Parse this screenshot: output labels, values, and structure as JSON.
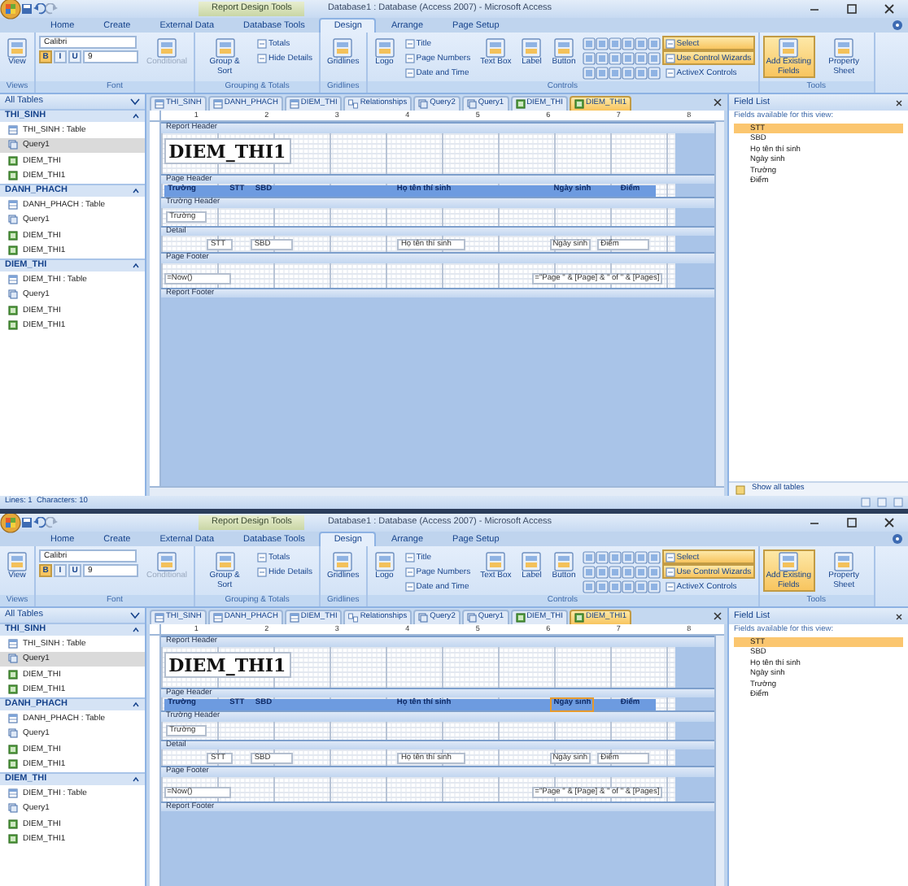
{
  "windows": [
    {
      "title": "Database1 : Database (Access 2007) - Microsoft Access",
      "context_label": "Report Design Tools",
      "ribbon_tabs": [
        {
          "label": "Home",
          "selected": false
        },
        {
          "label": "Create",
          "selected": false
        },
        {
          "label": "External Data",
          "selected": false
        },
        {
          "label": "Database Tools",
          "selected": false
        },
        {
          "label": "Design",
          "selected": true
        },
        {
          "label": "Arrange",
          "selected": false
        },
        {
          "label": "Page Setup",
          "selected": false
        }
      ],
      "ribbon_groups": [
        {
          "label": "Views",
          "controls": [
            {
              "kind": "large",
              "label": "View"
            }
          ]
        },
        {
          "label": "Font",
          "controls": [
            {
              "kind": "combo",
              "label": "Calibri"
            },
            {
              "kind": "format",
              "label": "B",
              "selected": true
            },
            {
              "kind": "format",
              "label": "I",
              "selected": false
            },
            {
              "kind": "format",
              "label": "U",
              "selected": false
            },
            {
              "kind": "combo",
              "label": "9"
            },
            {
              "kind": "large",
              "label": "Conditional",
              "disabled": true
            }
          ]
        },
        {
          "label": "Grouping & Totals",
          "controls": [
            {
              "kind": "large",
              "label": "Group & Sort"
            },
            {
              "kind": "small",
              "label": "Totals"
            },
            {
              "kind": "small",
              "label": "Hide Details"
            }
          ]
        },
        {
          "label": "Gridlines",
          "controls": [
            {
              "kind": "large",
              "label": "Gridlines"
            }
          ]
        },
        {
          "label": "Controls",
          "controls": [
            {
              "kind": "large",
              "label": "Logo"
            },
            {
              "kind": "small",
              "label": "Title"
            },
            {
              "kind": "small",
              "label": "Page Numbers"
            },
            {
              "kind": "small",
              "label": "Date and Time"
            },
            {
              "kind": "large",
              "label": "Text Box"
            },
            {
              "kind": "large",
              "label": "Label"
            },
            {
              "kind": "large",
              "label": "Button"
            },
            {
              "kind": "gallery"
            },
            {
              "kind": "small",
              "label": "Select",
              "selected": true
            },
            {
              "kind": "small",
              "label": "Use Control Wizards",
              "selected": true
            },
            {
              "kind": "small",
              "label": "ActiveX Controls",
              "selected": false
            }
          ]
        },
        {
          "label": "Tools",
          "controls": [
            {
              "kind": "large",
              "label": "Add Existing Fields",
              "selected": true
            },
            {
              "kind": "large",
              "label": "Property Sheet",
              "selected": false
            }
          ]
        }
      ],
      "nav": {
        "title": "All Tables",
        "groups": [
          {
            "name": "THI_SINH",
            "items": [
              {
                "kind": "table",
                "label": "THI_SINH : Table",
                "selected": false
              },
              {
                "kind": "query",
                "label": "Query1",
                "selected": true
              },
              {
                "kind": "report",
                "label": "DIEM_THI",
                "selected": false
              },
              {
                "kind": "report",
                "label": "DIEM_THI1",
                "selected": false
              }
            ]
          },
          {
            "name": "DANH_PHACH",
            "items": [
              {
                "kind": "table",
                "label": "DANH_PHACH : Table",
                "selected": false
              },
              {
                "kind": "query",
                "label": "Query1",
                "selected": false
              },
              {
                "kind": "report",
                "label": "DIEM_THI",
                "selected": false
              },
              {
                "kind": "report",
                "label": "DIEM_THI1",
                "selected": false
              }
            ]
          },
          {
            "name": "DIEM_THI",
            "items": [
              {
                "kind": "table",
                "label": "DIEM_THI : Table",
                "selected": false
              },
              {
                "kind": "query",
                "label": "Query1",
                "selected": false
              },
              {
                "kind": "report",
                "label": "DIEM_THI",
                "selected": false
              },
              {
                "kind": "report",
                "label": "DIEM_THI1",
                "selected": false
              }
            ]
          }
        ]
      },
      "document_tabs": [
        {
          "kind": "table",
          "label": "THI_SINH",
          "selected": false
        },
        {
          "kind": "table",
          "label": "DANH_PHACH",
          "selected": false
        },
        {
          "kind": "table",
          "label": "DIEM_THI",
          "selected": false
        },
        {
          "kind": "relationships",
          "label": "Relationships",
          "selected": false
        },
        {
          "kind": "query",
          "label": "Query2",
          "selected": false
        },
        {
          "kind": "query",
          "label": "Query1",
          "selected": false
        },
        {
          "kind": "report",
          "label": "DIEM_THI",
          "selected": false
        },
        {
          "kind": "report",
          "label": "DIEM_THI1",
          "selected": true
        }
      ],
      "ruler": [
        "1",
        "2",
        "3",
        "4",
        "5",
        "6",
        "7",
        "8"
      ],
      "sections": [
        {
          "name": "Report Header",
          "kind": "report_header",
          "controls": [
            {
              "kind": "title",
              "text": "DIEM_THI1",
              "selected": false
            }
          ]
        },
        {
          "name": "Page Header",
          "kind": "page_header",
          "controls": [
            {
              "kind": "label",
              "text": "Trường",
              "selected": false
            },
            {
              "kind": "label",
              "text": "STT",
              "selected": false
            },
            {
              "kind": "label",
              "text": "SBD",
              "selected": false
            },
            {
              "kind": "label",
              "text": "Họ tên thí sinh",
              "selected": false
            },
            {
              "kind": "label",
              "text": "Ngày sinh",
              "selected": false
            },
            {
              "kind": "label",
              "text": "Điểm",
              "selected": false
            }
          ]
        },
        {
          "name": "Trường Header",
          "kind": "group_header",
          "controls": [
            {
              "kind": "textbox",
              "text": "Trường",
              "selected": false
            }
          ]
        },
        {
          "name": "Detail",
          "kind": "detail",
          "controls": [
            {
              "kind": "textbox",
              "text": "STT",
              "selected": false
            },
            {
              "kind": "textbox",
              "text": "SBD",
              "selected": false
            },
            {
              "kind": "textbox",
              "text": "Họ tên thí sinh",
              "selected": false
            },
            {
              "kind": "textbox",
              "text": "Ngày sinh",
              "selected": false
            },
            {
              "kind": "textbox",
              "text": "Điểm",
              "selected": false
            }
          ]
        },
        {
          "name": "Page Footer",
          "kind": "page_footer",
          "controls": [
            {
              "kind": "textbox",
              "text": "=Now()",
              "selected": false
            },
            {
              "kind": "textbox",
              "text": "=\"Page \" & [Page] & \" of \" & [Pages]",
              "selected": false
            }
          ]
        },
        {
          "name": "Report Footer",
          "kind": "report_footer"
        }
      ],
      "field_list": {
        "title": "Field List",
        "subtitle": "Fields available for this view:",
        "fields": [
          {
            "label": "STT",
            "selected": true
          },
          {
            "label": "SBD",
            "selected": false
          },
          {
            "label": "Họ tên thí sinh",
            "selected": false
          },
          {
            "label": "Ngày sinh",
            "selected": false
          },
          {
            "label": "Trường",
            "selected": false
          },
          {
            "label": "Điểm",
            "selected": false
          }
        ],
        "footer_link": "Show all tables"
      },
      "status_bar": "Lines: 1  Characters: 10"
    },
    {
      "title": "Database1 : Database (Access 2007) - Microsoft Access",
      "context_label": "Report Design Tools",
      "ribbon_tabs": [
        {
          "label": "Home",
          "selected": false
        },
        {
          "label": "Create",
          "selected": false
        },
        {
          "label": "External Data",
          "selected": false
        },
        {
          "label": "Database Tools",
          "selected": false
        },
        {
          "label": "Design",
          "selected": true
        },
        {
          "label": "Arrange",
          "selected": false
        },
        {
          "label": "Page Setup",
          "selected": false
        }
      ],
      "ribbon_groups": [
        {
          "label": "Views",
          "controls": [
            {
              "kind": "large",
              "label": "View"
            }
          ]
        },
        {
          "label": "Font",
          "controls": [
            {
              "kind": "combo",
              "label": "Calibri"
            },
            {
              "kind": "format",
              "label": "B",
              "selected": true
            },
            {
              "kind": "format",
              "label": "I",
              "selected": false
            },
            {
              "kind": "format",
              "label": "U",
              "selected": false
            },
            {
              "kind": "combo",
              "label": "9"
            },
            {
              "kind": "large",
              "label": "Conditional",
              "disabled": true
            }
          ]
        },
        {
          "label": "Grouping & Totals",
          "controls": [
            {
              "kind": "large",
              "label": "Group & Sort"
            },
            {
              "kind": "small",
              "label": "Totals"
            },
            {
              "kind": "small",
              "label": "Hide Details"
            }
          ]
        },
        {
          "label": "Gridlines",
          "controls": [
            {
              "kind": "large",
              "label": "Gridlines"
            }
          ]
        },
        {
          "label": "Controls",
          "controls": [
            {
              "kind": "large",
              "label": "Logo"
            },
            {
              "kind": "small",
              "label": "Title"
            },
            {
              "kind": "small",
              "label": "Page Numbers"
            },
            {
              "kind": "small",
              "label": "Date and Time"
            },
            {
              "kind": "large",
              "label": "Text Box"
            },
            {
              "kind": "large",
              "label": "Label"
            },
            {
              "kind": "large",
              "label": "Button"
            },
            {
              "kind": "gallery"
            },
            {
              "kind": "small",
              "label": "Select",
              "selected": true
            },
            {
              "kind": "small",
              "label": "Use Control Wizards",
              "selected": true
            },
            {
              "kind": "small",
              "label": "ActiveX Controls",
              "selected": false
            }
          ]
        },
        {
          "label": "Tools",
          "controls": [
            {
              "kind": "large",
              "label": "Add Existing Fields",
              "selected": true
            },
            {
              "kind": "large",
              "label": "Property Sheet",
              "selected": false
            }
          ]
        }
      ],
      "nav": {
        "title": "All Tables",
        "groups": [
          {
            "name": "THI_SINH",
            "items": [
              {
                "kind": "table",
                "label": "THI_SINH : Table",
                "selected": false
              },
              {
                "kind": "query",
                "label": "Query1",
                "selected": true
              },
              {
                "kind": "report",
                "label": "DIEM_THI",
                "selected": false
              },
              {
                "kind": "report",
                "label": "DIEM_THI1",
                "selected": false
              }
            ]
          },
          {
            "name": "DANH_PHACH",
            "items": [
              {
                "kind": "table",
                "label": "DANH_PHACH : Table",
                "selected": false
              },
              {
                "kind": "query",
                "label": "Query1",
                "selected": false
              },
              {
                "kind": "report",
                "label": "DIEM_THI",
                "selected": false
              },
              {
                "kind": "report",
                "label": "DIEM_THI1",
                "selected": false
              }
            ]
          },
          {
            "name": "DIEM_THI",
            "items": [
              {
                "kind": "table",
                "label": "DIEM_THI : Table",
                "selected": false
              },
              {
                "kind": "query",
                "label": "Query1",
                "selected": false
              },
              {
                "kind": "report",
                "label": "DIEM_THI",
                "selected": false
              },
              {
                "kind": "report",
                "label": "DIEM_THI1",
                "selected": false
              }
            ]
          }
        ]
      },
      "document_tabs": [
        {
          "kind": "table",
          "label": "THI_SINH",
          "selected": false
        },
        {
          "kind": "table",
          "label": "DANH_PHACH",
          "selected": false
        },
        {
          "kind": "table",
          "label": "DIEM_THI",
          "selected": false
        },
        {
          "kind": "relationships",
          "label": "Relationships",
          "selected": false
        },
        {
          "kind": "query",
          "label": "Query2",
          "selected": false
        },
        {
          "kind": "query",
          "label": "Query1",
          "selected": false
        },
        {
          "kind": "report",
          "label": "DIEM_THI",
          "selected": false
        },
        {
          "kind": "report",
          "label": "DIEM_THI1",
          "selected": true
        }
      ],
      "ruler": [
        "1",
        "2",
        "3",
        "4",
        "5",
        "6",
        "7",
        "8"
      ],
      "sections": [
        {
          "name": "Report Header",
          "kind": "report_header",
          "controls": [
            {
              "kind": "title",
              "text": "DIEM_THI1",
              "selected": false
            }
          ]
        },
        {
          "name": "Page Header",
          "kind": "page_header",
          "controls": [
            {
              "kind": "label",
              "text": "Trường",
              "selected": false
            },
            {
              "kind": "label",
              "text": "STT",
              "selected": false
            },
            {
              "kind": "label",
              "text": "SBD",
              "selected": false
            },
            {
              "kind": "label",
              "text": "Họ tên thí sinh",
              "selected": false
            },
            {
              "kind": "label",
              "text": "Ngày sinh",
              "selected": true
            },
            {
              "kind": "label",
              "text": "Điểm",
              "selected": false
            }
          ]
        },
        {
          "name": "Trường Header",
          "kind": "group_header",
          "controls": [
            {
              "kind": "textbox",
              "text": "Trường",
              "selected": false
            }
          ]
        },
        {
          "name": "Detail",
          "kind": "detail",
          "controls": [
            {
              "kind": "textbox",
              "text": "STT",
              "selected": false
            },
            {
              "kind": "textbox",
              "text": "SBD",
              "selected": false
            },
            {
              "kind": "textbox",
              "text": "Họ tên thí sinh",
              "selected": false
            },
            {
              "kind": "textbox",
              "text": "Ngày sinh",
              "selected": false
            },
            {
              "kind": "textbox",
              "text": "Điểm",
              "selected": false
            }
          ]
        },
        {
          "name": "Page Footer",
          "kind": "page_footer",
          "controls": [
            {
              "kind": "textbox",
              "text": "=Now()",
              "selected": false
            },
            {
              "kind": "textbox",
              "text": "=\"Page \" & [Page] & \" of \" & [Pages]",
              "selected": false
            }
          ]
        },
        {
          "name": "Report Footer",
          "kind": "report_footer"
        }
      ],
      "field_list": {
        "title": "Field List",
        "subtitle": "Fields available for this view:",
        "fields": [
          {
            "label": "STT",
            "selected": true
          },
          {
            "label": "SBD",
            "selected": false
          },
          {
            "label": "Họ tên thí sinh",
            "selected": false
          },
          {
            "label": "Ngày sinh",
            "selected": false
          },
          {
            "label": "Trường",
            "selected": false
          },
          {
            "label": "Điểm",
            "selected": false
          }
        ]
      }
    }
  ]
}
